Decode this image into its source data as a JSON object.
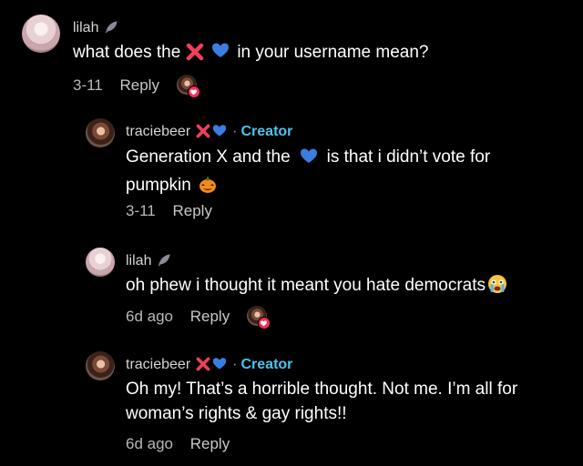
{
  "comments": [
    {
      "username": "lilah",
      "text_before": "what does the",
      "text_after": "in your username mean?",
      "date": "3-11",
      "reply_label": "Reply"
    },
    {
      "username": "traciebeer",
      "creator_label": "Creator",
      "text_before": "Generation X and the",
      "text_after": "is that i didn’t vote for",
      "text_line2": "pumpkin",
      "date": "3-11",
      "reply_label": "Reply"
    },
    {
      "username": "lilah",
      "text": "oh phew i thought it meant you hate democrats",
      "date": "6d ago",
      "reply_label": "Reply"
    },
    {
      "username": "traciebeer",
      "creator_label": "Creator",
      "text_line1": "Oh my! That’s a horrible thought. Not me. I’m all for",
      "text_line2": "woman’s rights & gay rights!!",
      "date": "6d ago",
      "reply_label": "Reply"
    }
  ],
  "icons": {
    "feather": "feather-icon",
    "cross_mark": "cross-mark-icon",
    "blue_heart": "blue-heart-icon",
    "pumpkin": "jack-o-lantern-icon",
    "crying_face": "crying-face-icon"
  },
  "colors": {
    "background": "#000000",
    "creator": "#4fc3e8",
    "cross": "#f0405a",
    "heart": "#3b7de0"
  }
}
